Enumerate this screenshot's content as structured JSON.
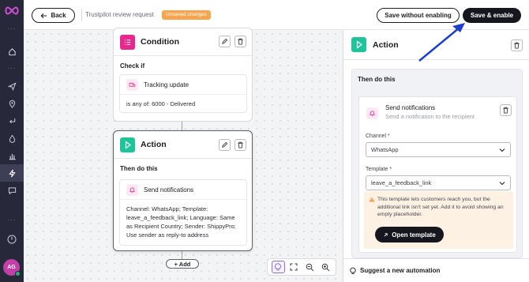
{
  "topbar": {
    "back_label": "Back",
    "breadcrumb": "Trustpilot review request",
    "status_badge": "Unsaved changes",
    "save_without_label": "Save without enabling",
    "save_enable_label": "Save & enable"
  },
  "sidebar": {
    "avatar_initials": "AG",
    "items": [
      "home-icon",
      "send-icon",
      "location-icon",
      "return-icon",
      "drop-icon",
      "chart-icon",
      "lightning-icon",
      "chat-icon"
    ]
  },
  "canvas": {
    "condition_node": {
      "title": "Condition",
      "section_label": "Check if",
      "rule_title": "Tracking update",
      "rule_value": "is any of: 6000 - Delivered"
    },
    "action_node": {
      "title": "Action",
      "section_label": "Then do this",
      "step_title": "Send notifications",
      "step_detail": "Channel: WhatsApp; Template: leave_a_feedback_link; Language: Same as Recipient Country; Sender: ShippyPro; Use sender as reply-to address"
    },
    "add_label": "+ Add"
  },
  "panel": {
    "title": "Action",
    "section_label": "Then do this",
    "step_title": "Send notifications",
    "step_subtitle": "Send a notification to the recipient",
    "channel_label": "Channel *",
    "channel_value": "WhatsApp",
    "template_label": "Template *",
    "template_value": "leave_a_feedback_link",
    "warning_text": "This template lets customers reach you, but the additional link isn't set yet. Add it to avoid showing an empty placeholder.",
    "open_template_label": "Open template",
    "suggest_label": "Suggest a new automation"
  },
  "colors": {
    "condition_accent": "#e9288e",
    "action_accent": "#1fc59a",
    "primary": "#15161e",
    "badge": "#f6a54e",
    "rail": "#27283a",
    "annotation_arrow": "#1c3fcf"
  }
}
